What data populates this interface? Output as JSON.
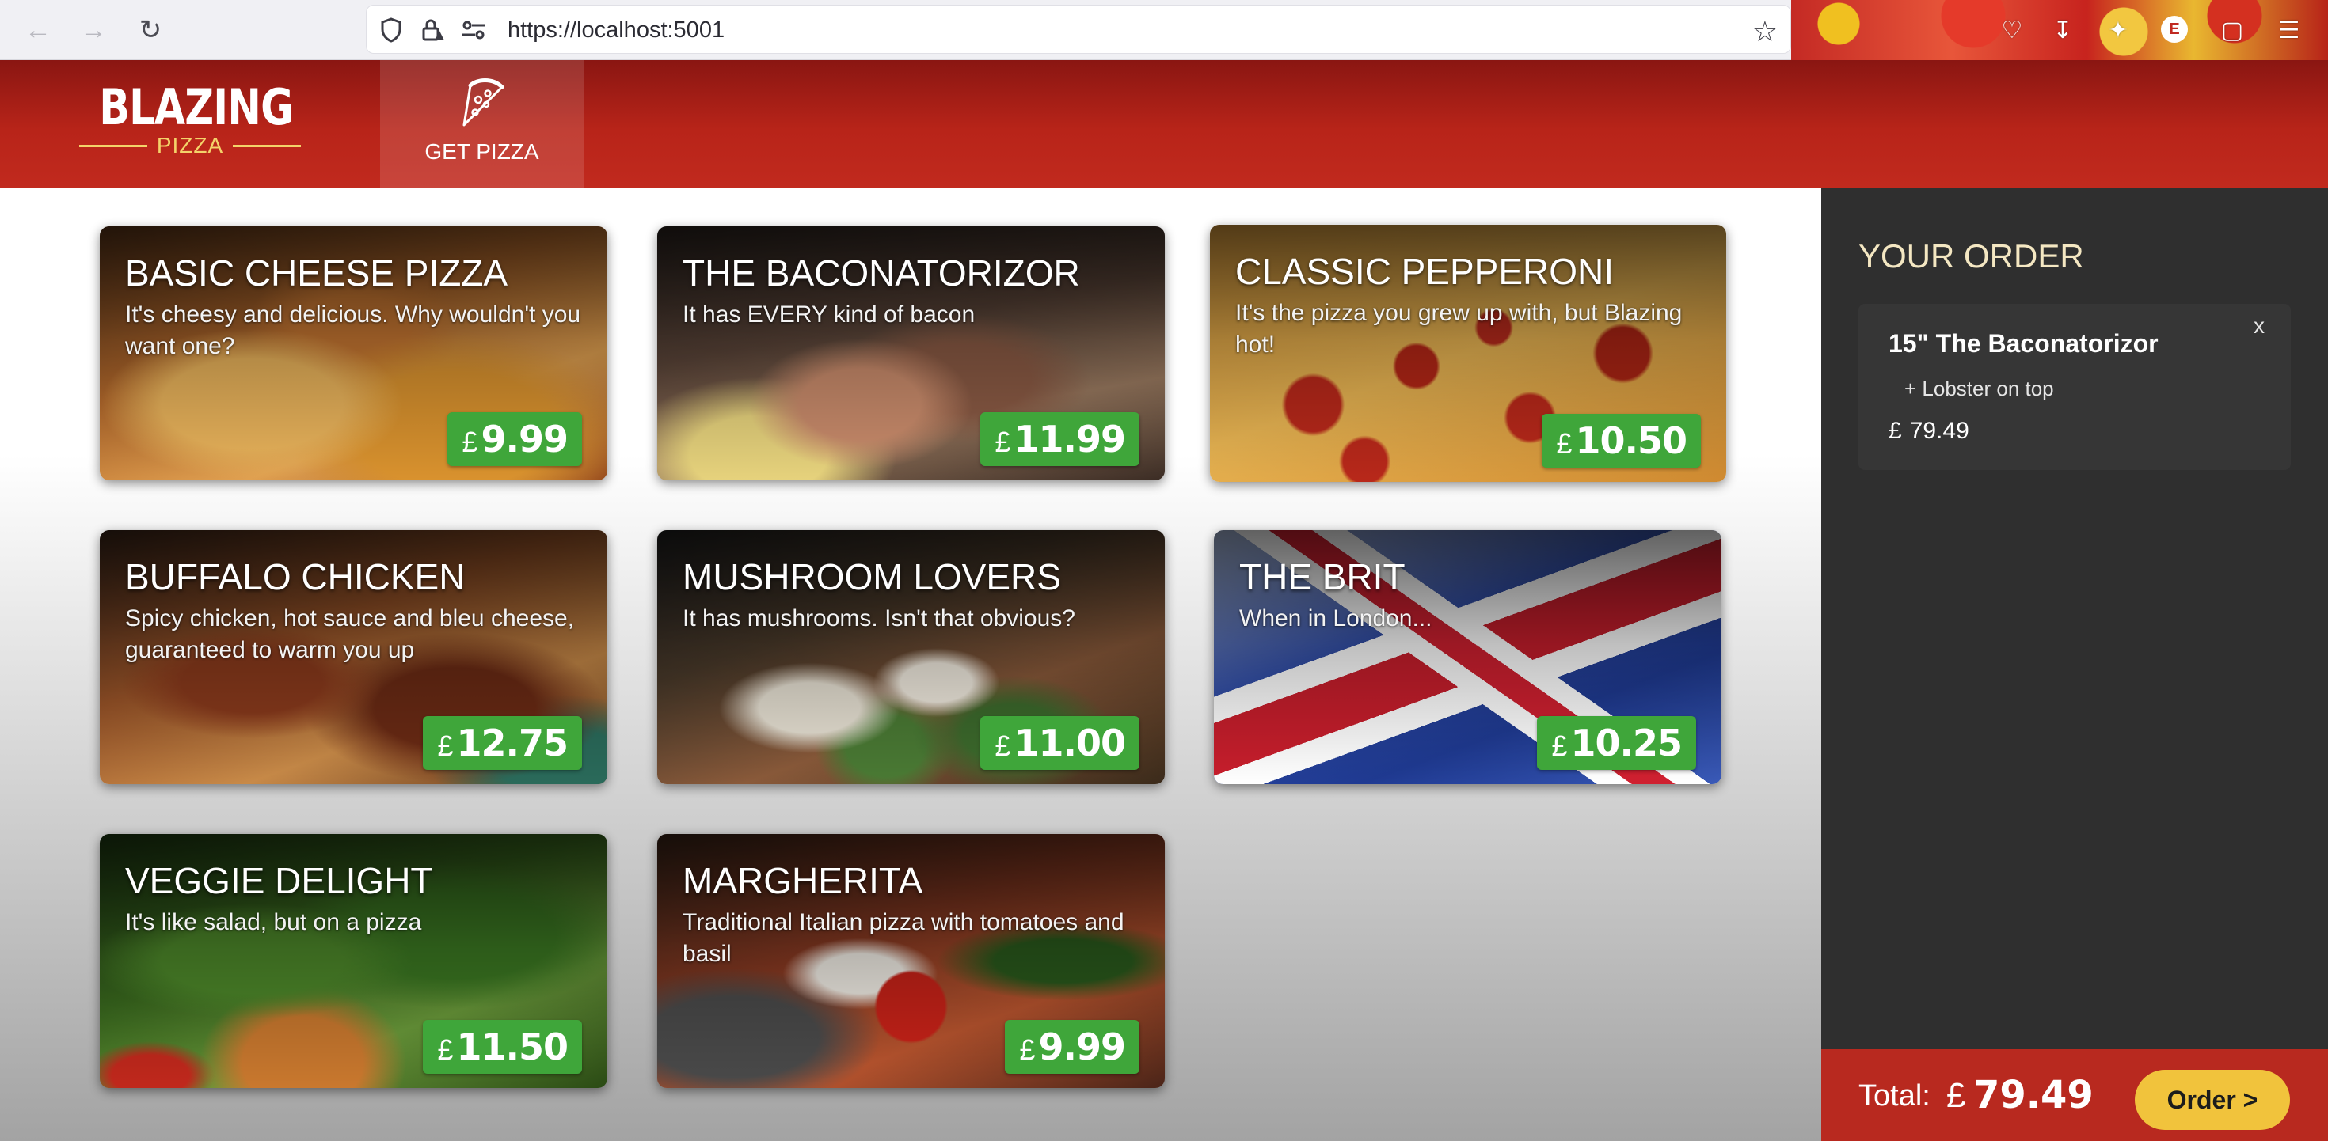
{
  "browser": {
    "url": "https://localhost:5001",
    "profile_initial": "E"
  },
  "header": {
    "logo_main": "BLAZING",
    "logo_sub": "PIZZA",
    "nav_tab_label": "GET PIZZA"
  },
  "specials": [
    {
      "title": "BASIC CHEESE PIZZA",
      "description": "It's cheesy and delicious. Why wouldn't you want one?",
      "currency": "£",
      "price": "9.99"
    },
    {
      "title": "THE BACONATORIZOR",
      "description": "It has EVERY kind of bacon",
      "currency": "£",
      "price": "11.99"
    },
    {
      "title": "CLASSIC PEPPERONI",
      "description": "It's the pizza you grew up with, but Blazing hot!",
      "currency": "£",
      "price": "10.50"
    },
    {
      "title": "BUFFALO CHICKEN",
      "description": "Spicy chicken, hot sauce and bleu cheese, guaranteed to warm you up",
      "currency": "£",
      "price": "12.75"
    },
    {
      "title": "MUSHROOM LOVERS",
      "description": "It has mushrooms. Isn't that obvious?",
      "currency": "£",
      "price": "11.00"
    },
    {
      "title": "THE BRIT",
      "description": "When in London...",
      "currency": "£",
      "price": "10.25"
    },
    {
      "title": "VEGGIE DELIGHT",
      "description": "It's like salad, but on a pizza",
      "currency": "£",
      "price": "11.50"
    },
    {
      "title": "MARGHERITA",
      "description": "Traditional Italian pizza with tomatoes and basil",
      "currency": "£",
      "price": "9.99"
    }
  ],
  "order": {
    "title": "YOUR ORDER",
    "items": [
      {
        "name": "15\" The Baconatorizor",
        "topping": "+ Lobster on top",
        "currency": "£",
        "price": "79.49",
        "remove_label": "x"
      }
    ],
    "total_label": "Total:",
    "total_currency": "£",
    "total": "79.49",
    "order_button": "Order >"
  },
  "colors": {
    "header_red": "#b82419",
    "price_green": "#3fa63a",
    "sidebar_bg": "#2f2f2f",
    "footer_red": "#b8291f",
    "order_button": "#f1c33c"
  }
}
